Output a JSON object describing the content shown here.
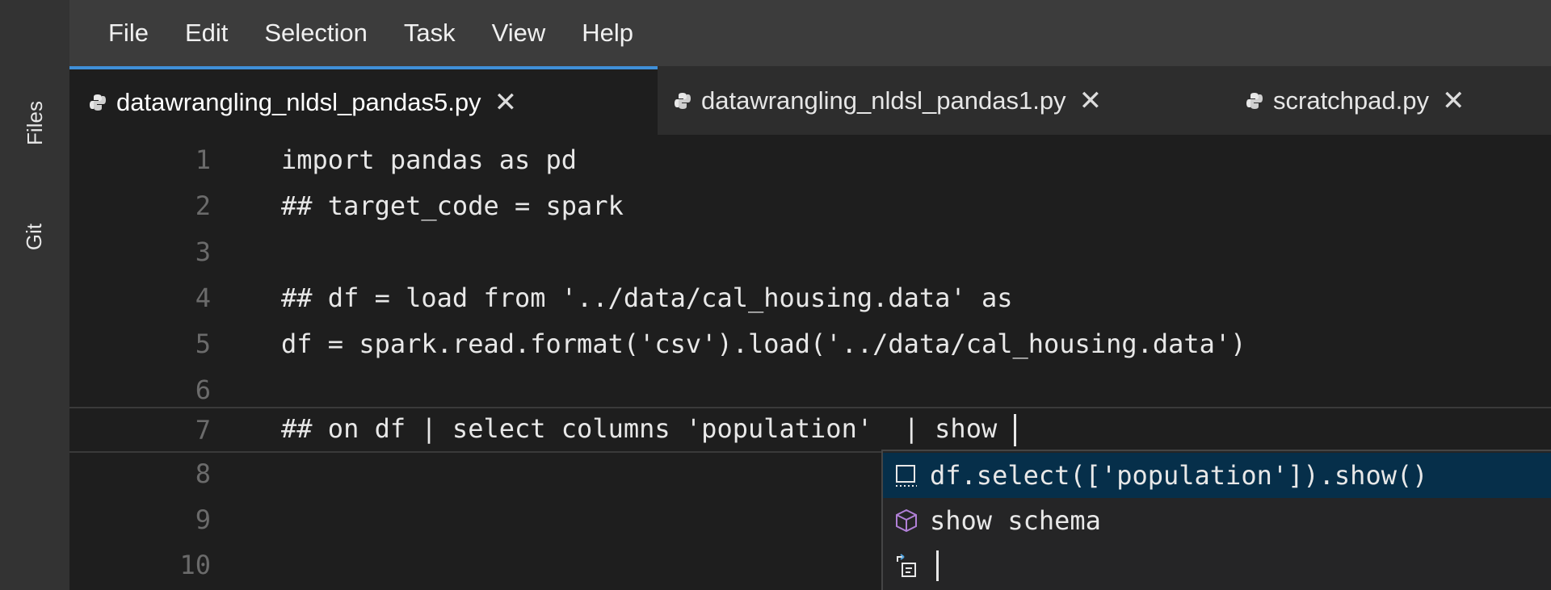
{
  "activity_bar": {
    "items": [
      {
        "label": "Files"
      },
      {
        "label": "Git"
      }
    ]
  },
  "menu": {
    "items": [
      "File",
      "Edit",
      "Selection",
      "Task",
      "View",
      "Help"
    ]
  },
  "tabs": [
    {
      "label": "datawrangling_nldsl_pandas5.py",
      "active": true
    },
    {
      "label": "datawrangling_nldsl_pandas1.py",
      "active": false
    },
    {
      "label": "scratchpad.py",
      "active": false
    }
  ],
  "tab_close_glyph": "✕",
  "editor": {
    "lines": [
      {
        "number": "1",
        "text": "import pandas as pd"
      },
      {
        "number": "2",
        "text": "## target_code = spark"
      },
      {
        "number": "3",
        "text": ""
      },
      {
        "number": "4",
        "text": "## df = load from '../data/cal_housing.data' as"
      },
      {
        "number": "5",
        "text": "df = spark.read.format('csv').load('../data/cal_housing.data')"
      },
      {
        "number": "6",
        "text": ""
      },
      {
        "number": "7",
        "text": "## on df | select columns 'population'  | show "
      },
      {
        "number": "8",
        "text": ""
      },
      {
        "number": "9",
        "text": ""
      },
      {
        "number": "10",
        "text": ""
      }
    ]
  },
  "suggestions": [
    {
      "label": "df.select(['population']).show()",
      "icon": "snippet-icon"
    },
    {
      "label": "show schema",
      "icon": "cube-icon"
    },
    {
      "label": "",
      "icon": "insert-text-icon"
    }
  ],
  "colors": {
    "accent": "#3f8fd8",
    "editor_bg": "#1e1e1e",
    "menu_bg": "#3c3c3c",
    "suggest_selected": "#062f4a"
  }
}
